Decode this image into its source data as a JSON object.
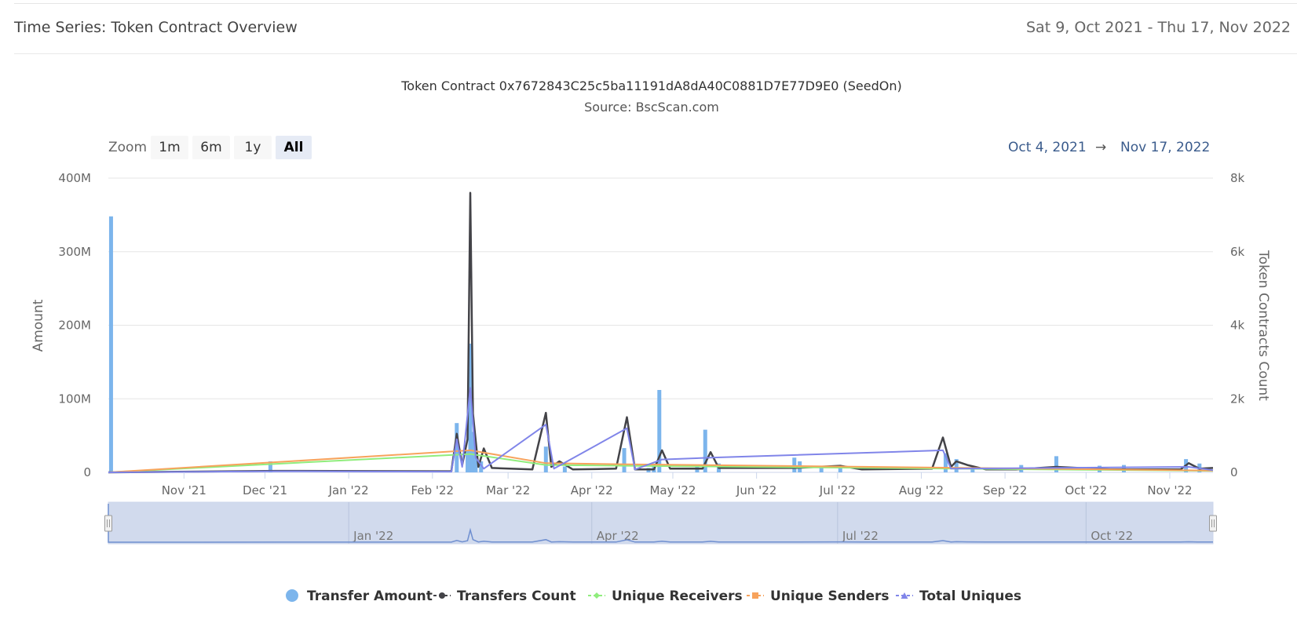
{
  "header": {
    "title": "Time Series: Token Contract Overview",
    "date_range": "Sat 9, Oct 2021 - Thu 17, Nov 2022"
  },
  "range_selector": {
    "zoom_label": "Zoom",
    "buttons": [
      {
        "label": "1m",
        "selected": false
      },
      {
        "label": "6m",
        "selected": false
      },
      {
        "label": "1y",
        "selected": false
      },
      {
        "label": "All",
        "selected": true
      }
    ],
    "from": "Oct 4, 2021",
    "arrow": "→",
    "to": "Nov 17, 2022"
  },
  "chart_data": {
    "type": "bar",
    "title": "Token Contract 0x7672843C25c5ba11191dA8dA40C0881D7E77D9E0 (SeedOn)",
    "subtitle": "Source: BscScan.com",
    "x_range": [
      "2021-10-04",
      "2022-11-17"
    ],
    "x_ticks": [
      {
        "date": "2021-11-01",
        "label": "Nov '21"
      },
      {
        "date": "2021-12-01",
        "label": "Dec '21"
      },
      {
        "date": "2022-01-01",
        "label": "Jan '22"
      },
      {
        "date": "2022-02-01",
        "label": "Feb '22"
      },
      {
        "date": "2022-03-01",
        "label": "Mar '22"
      },
      {
        "date": "2022-04-01",
        "label": "Apr '22"
      },
      {
        "date": "2022-05-01",
        "label": "May '22"
      },
      {
        "date": "2022-06-01",
        "label": "Jun '22"
      },
      {
        "date": "2022-07-01",
        "label": "Jul '22"
      },
      {
        "date": "2022-08-01",
        "label": "Aug '22"
      },
      {
        "date": "2022-09-01",
        "label": "Sep '22"
      },
      {
        "date": "2022-10-01",
        "label": "Oct '22"
      },
      {
        "date": "2022-11-01",
        "label": "Nov '22"
      }
    ],
    "y_left": {
      "label": "Amount",
      "ylim": [
        0,
        400000000
      ],
      "ticks": [
        "0",
        "100M",
        "200M",
        "300M",
        "400M"
      ]
    },
    "y_right": {
      "label": "Token Contracts Count",
      "ylim": [
        0,
        8000
      ],
      "ticks": [
        "0",
        "2k",
        "4k",
        "6k",
        "8k"
      ]
    },
    "grid": true,
    "legend_position": "bottom-center",
    "series": [
      {
        "name": "Transfer Amount",
        "type": "bar",
        "axis": "left",
        "color": "#7cb5ec",
        "points": [
          [
            "2021-10-05",
            348000000
          ],
          [
            "2021-12-03",
            15000000
          ],
          [
            "2022-02-10",
            67000000
          ],
          [
            "2022-02-14",
            30000000
          ],
          [
            "2022-02-15",
            175000000
          ],
          [
            "2022-02-16",
            55000000
          ],
          [
            "2022-02-17",
            28000000
          ],
          [
            "2022-02-19",
            15000000
          ],
          [
            "2022-03-15",
            35000000
          ],
          [
            "2022-03-22",
            8000000
          ],
          [
            "2022-04-13",
            33000000
          ],
          [
            "2022-04-24",
            12000000
          ],
          [
            "2022-04-22",
            6000000
          ],
          [
            "2022-04-26",
            112000000
          ],
          [
            "2022-05-13",
            58000000
          ],
          [
            "2022-05-10",
            10000000
          ],
          [
            "2022-05-18",
            12000000
          ],
          [
            "2022-06-15",
            20000000
          ],
          [
            "2022-06-17",
            15000000
          ],
          [
            "2022-06-25",
            8000000
          ],
          [
            "2022-07-02",
            9000000
          ],
          [
            "2022-08-10",
            26000000
          ],
          [
            "2022-08-14",
            18000000
          ],
          [
            "2022-08-20",
            9000000
          ],
          [
            "2022-09-07",
            10000000
          ],
          [
            "2022-09-20",
            22000000
          ],
          [
            "2022-10-06",
            9000000
          ],
          [
            "2022-10-15",
            10000000
          ],
          [
            "2022-11-07",
            18000000
          ],
          [
            "2022-11-12",
            12000000
          ]
        ]
      },
      {
        "name": "Transfers Count",
        "type": "line",
        "axis": "right",
        "color": "#434348",
        "points": [
          [
            "2021-10-04",
            0
          ],
          [
            "2021-12-05",
            40
          ],
          [
            "2022-02-08",
            30
          ],
          [
            "2022-02-10",
            1050
          ],
          [
            "2022-02-12",
            200
          ],
          [
            "2022-02-14",
            900
          ],
          [
            "2022-02-15",
            7600
          ],
          [
            "2022-02-16",
            1600
          ],
          [
            "2022-02-18",
            150
          ],
          [
            "2022-02-20",
            650
          ],
          [
            "2022-02-23",
            120
          ],
          [
            "2022-03-10",
            80
          ],
          [
            "2022-03-15",
            1620
          ],
          [
            "2022-03-17",
            150
          ],
          [
            "2022-03-20",
            300
          ],
          [
            "2022-03-25",
            80
          ],
          [
            "2022-04-10",
            100
          ],
          [
            "2022-04-14",
            1500
          ],
          [
            "2022-04-17",
            80
          ],
          [
            "2022-04-24",
            80
          ],
          [
            "2022-04-27",
            600
          ],
          [
            "2022-04-30",
            100
          ],
          [
            "2022-05-12",
            100
          ],
          [
            "2022-05-15",
            550
          ],
          [
            "2022-05-18",
            120
          ],
          [
            "2022-06-15",
            120
          ],
          [
            "2022-07-02",
            180
          ],
          [
            "2022-07-10",
            80
          ],
          [
            "2022-08-05",
            100
          ],
          [
            "2022-08-09",
            950
          ],
          [
            "2022-08-12",
            150
          ],
          [
            "2022-08-14",
            300
          ],
          [
            "2022-08-18",
            200
          ],
          [
            "2022-08-25",
            80
          ],
          [
            "2022-09-05",
            80
          ],
          [
            "2022-09-20",
            150
          ],
          [
            "2022-10-10",
            80
          ],
          [
            "2022-11-05",
            80
          ],
          [
            "2022-11-08",
            250
          ],
          [
            "2022-11-12",
            100
          ],
          [
            "2022-11-17",
            120
          ]
        ]
      },
      {
        "name": "Unique Receivers",
        "type": "line",
        "axis": "right",
        "color": "#90ed7d",
        "points": [
          [
            "2021-10-04",
            0
          ],
          [
            "2022-02-15",
            500
          ],
          [
            "2022-03-15",
            200
          ],
          [
            "2022-04-14",
            180
          ],
          [
            "2022-11-17",
            40
          ]
        ]
      },
      {
        "name": "Unique Senders",
        "type": "line",
        "axis": "right",
        "color": "#f7a35c",
        "points": [
          [
            "2021-10-04",
            0
          ],
          [
            "2022-02-15",
            600
          ],
          [
            "2022-03-15",
            250
          ],
          [
            "2022-04-14",
            220
          ],
          [
            "2022-11-17",
            50
          ]
        ]
      },
      {
        "name": "Total Uniques",
        "type": "line",
        "axis": "right",
        "color": "#8085e9",
        "points": [
          [
            "2021-10-04",
            0
          ],
          [
            "2021-12-05",
            30
          ],
          [
            "2022-02-08",
            20
          ],
          [
            "2022-02-10",
            900
          ],
          [
            "2022-02-12",
            150
          ],
          [
            "2022-02-15",
            2300
          ],
          [
            "2022-02-17",
            400
          ],
          [
            "2022-02-20",
            100
          ],
          [
            "2022-03-15",
            1300
          ],
          [
            "2022-03-18",
            100
          ],
          [
            "2022-04-14",
            1200
          ],
          [
            "2022-04-17",
            80
          ],
          [
            "2022-04-27",
            350
          ],
          [
            "2022-05-15",
            400
          ],
          [
            "2022-08-09",
            600
          ],
          [
            "2022-08-12",
            100
          ],
          [
            "2022-11-08",
            150
          ],
          [
            "2022-11-17",
            60
          ]
        ]
      }
    ],
    "navigator": {
      "labels": [
        {
          "date": "2022-01-01",
          "label": "Jan '22"
        },
        {
          "date": "2022-04-01",
          "label": "Apr '22"
        },
        {
          "date": "2022-07-01",
          "label": "Jul '22"
        },
        {
          "date": "2022-10-01",
          "label": "Oct '22"
        }
      ]
    }
  }
}
